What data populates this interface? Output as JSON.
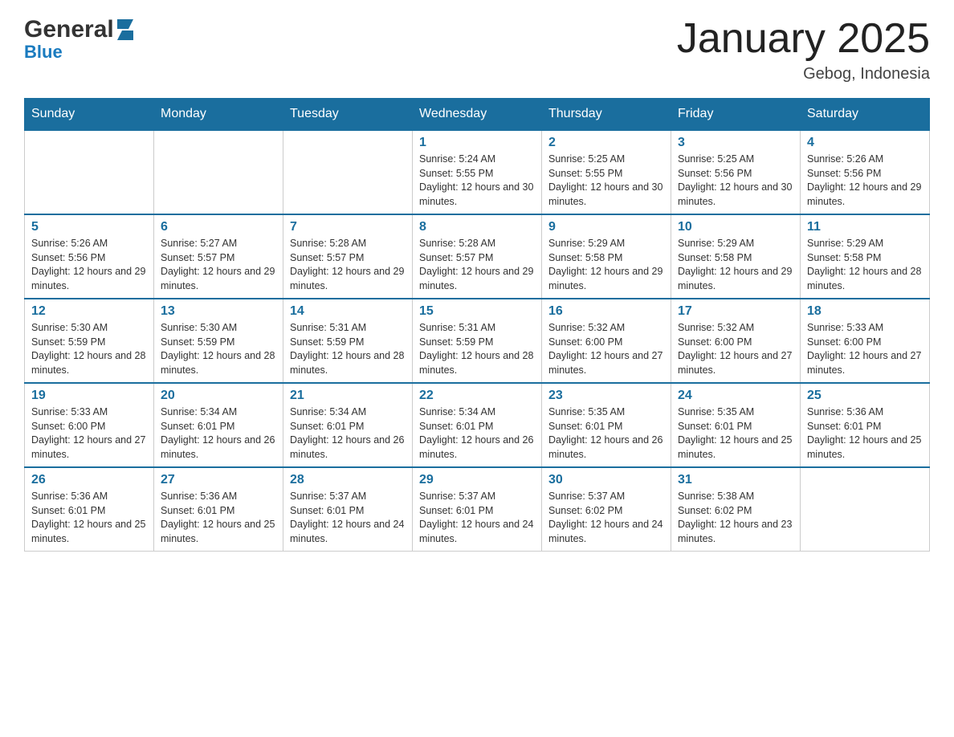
{
  "header": {
    "logo_general": "General",
    "logo_blue": "Blue",
    "month_title": "January 2025",
    "location": "Gebog, Indonesia"
  },
  "calendar": {
    "days_of_week": [
      "Sunday",
      "Monday",
      "Tuesday",
      "Wednesday",
      "Thursday",
      "Friday",
      "Saturday"
    ],
    "weeks": [
      [
        {
          "day": "",
          "info": ""
        },
        {
          "day": "",
          "info": ""
        },
        {
          "day": "",
          "info": ""
        },
        {
          "day": "1",
          "info": "Sunrise: 5:24 AM\nSunset: 5:55 PM\nDaylight: 12 hours and 30 minutes."
        },
        {
          "day": "2",
          "info": "Sunrise: 5:25 AM\nSunset: 5:55 PM\nDaylight: 12 hours and 30 minutes."
        },
        {
          "day": "3",
          "info": "Sunrise: 5:25 AM\nSunset: 5:56 PM\nDaylight: 12 hours and 30 minutes."
        },
        {
          "day": "4",
          "info": "Sunrise: 5:26 AM\nSunset: 5:56 PM\nDaylight: 12 hours and 29 minutes."
        }
      ],
      [
        {
          "day": "5",
          "info": "Sunrise: 5:26 AM\nSunset: 5:56 PM\nDaylight: 12 hours and 29 minutes."
        },
        {
          "day": "6",
          "info": "Sunrise: 5:27 AM\nSunset: 5:57 PM\nDaylight: 12 hours and 29 minutes."
        },
        {
          "day": "7",
          "info": "Sunrise: 5:28 AM\nSunset: 5:57 PM\nDaylight: 12 hours and 29 minutes."
        },
        {
          "day": "8",
          "info": "Sunrise: 5:28 AM\nSunset: 5:57 PM\nDaylight: 12 hours and 29 minutes."
        },
        {
          "day": "9",
          "info": "Sunrise: 5:29 AM\nSunset: 5:58 PM\nDaylight: 12 hours and 29 minutes."
        },
        {
          "day": "10",
          "info": "Sunrise: 5:29 AM\nSunset: 5:58 PM\nDaylight: 12 hours and 29 minutes."
        },
        {
          "day": "11",
          "info": "Sunrise: 5:29 AM\nSunset: 5:58 PM\nDaylight: 12 hours and 28 minutes."
        }
      ],
      [
        {
          "day": "12",
          "info": "Sunrise: 5:30 AM\nSunset: 5:59 PM\nDaylight: 12 hours and 28 minutes."
        },
        {
          "day": "13",
          "info": "Sunrise: 5:30 AM\nSunset: 5:59 PM\nDaylight: 12 hours and 28 minutes."
        },
        {
          "day": "14",
          "info": "Sunrise: 5:31 AM\nSunset: 5:59 PM\nDaylight: 12 hours and 28 minutes."
        },
        {
          "day": "15",
          "info": "Sunrise: 5:31 AM\nSunset: 5:59 PM\nDaylight: 12 hours and 28 minutes."
        },
        {
          "day": "16",
          "info": "Sunrise: 5:32 AM\nSunset: 6:00 PM\nDaylight: 12 hours and 27 minutes."
        },
        {
          "day": "17",
          "info": "Sunrise: 5:32 AM\nSunset: 6:00 PM\nDaylight: 12 hours and 27 minutes."
        },
        {
          "day": "18",
          "info": "Sunrise: 5:33 AM\nSunset: 6:00 PM\nDaylight: 12 hours and 27 minutes."
        }
      ],
      [
        {
          "day": "19",
          "info": "Sunrise: 5:33 AM\nSunset: 6:00 PM\nDaylight: 12 hours and 27 minutes."
        },
        {
          "day": "20",
          "info": "Sunrise: 5:34 AM\nSunset: 6:01 PM\nDaylight: 12 hours and 26 minutes."
        },
        {
          "day": "21",
          "info": "Sunrise: 5:34 AM\nSunset: 6:01 PM\nDaylight: 12 hours and 26 minutes."
        },
        {
          "day": "22",
          "info": "Sunrise: 5:34 AM\nSunset: 6:01 PM\nDaylight: 12 hours and 26 minutes."
        },
        {
          "day": "23",
          "info": "Sunrise: 5:35 AM\nSunset: 6:01 PM\nDaylight: 12 hours and 26 minutes."
        },
        {
          "day": "24",
          "info": "Sunrise: 5:35 AM\nSunset: 6:01 PM\nDaylight: 12 hours and 25 minutes."
        },
        {
          "day": "25",
          "info": "Sunrise: 5:36 AM\nSunset: 6:01 PM\nDaylight: 12 hours and 25 minutes."
        }
      ],
      [
        {
          "day": "26",
          "info": "Sunrise: 5:36 AM\nSunset: 6:01 PM\nDaylight: 12 hours and 25 minutes."
        },
        {
          "day": "27",
          "info": "Sunrise: 5:36 AM\nSunset: 6:01 PM\nDaylight: 12 hours and 25 minutes."
        },
        {
          "day": "28",
          "info": "Sunrise: 5:37 AM\nSunset: 6:01 PM\nDaylight: 12 hours and 24 minutes."
        },
        {
          "day": "29",
          "info": "Sunrise: 5:37 AM\nSunset: 6:01 PM\nDaylight: 12 hours and 24 minutes."
        },
        {
          "day": "30",
          "info": "Sunrise: 5:37 AM\nSunset: 6:02 PM\nDaylight: 12 hours and 24 minutes."
        },
        {
          "day": "31",
          "info": "Sunrise: 5:38 AM\nSunset: 6:02 PM\nDaylight: 12 hours and 23 minutes."
        },
        {
          "day": "",
          "info": ""
        }
      ]
    ]
  }
}
